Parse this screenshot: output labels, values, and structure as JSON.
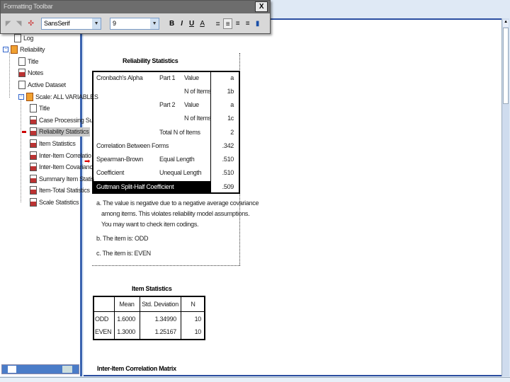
{
  "toolbar": {
    "title": "Formatting Toolbar",
    "close": "X",
    "font": "SansSerif",
    "size": "9",
    "bold": "B",
    "italic": "I",
    "underline": "U",
    "color": "A"
  },
  "tree": [
    {
      "label": "Log",
      "icon": "log-icon"
    },
    {
      "label": "Reliability",
      "icon": "book-icon"
    },
    {
      "label": "Title",
      "icon": "title-icon"
    },
    {
      "label": "Notes",
      "icon": "notes-icon"
    },
    {
      "label": "Active Dataset",
      "icon": "dataset-icon"
    },
    {
      "label": "Scale: ALL VARIABLES",
      "icon": "book-icon"
    },
    {
      "label": "Title",
      "icon": "title-icon"
    },
    {
      "label": "Case Processing Su",
      "icon": "table-icon"
    },
    {
      "label": "Reliability Statistics",
      "icon": "table-icon"
    },
    {
      "label": "Item Statistics",
      "icon": "table-icon"
    },
    {
      "label": "Inter-Item Correlatio",
      "icon": "table-icon"
    },
    {
      "label": "Inter-Item Covarianc",
      "icon": "table-icon"
    },
    {
      "label": "Summary Item Statis",
      "icon": "table-icon"
    },
    {
      "label": "Item-Total Statistics",
      "icon": "table-icon"
    },
    {
      "label": "Scale Statistics",
      "icon": "table-icon"
    }
  ],
  "reliability": {
    "title": "Reliability Statistics",
    "rows": [
      {
        "c1": "Cronbach's Alpha",
        "c2": "Part 1",
        "c3": "Value",
        "v": "a"
      },
      {
        "c1": "",
        "c2": "",
        "c3": "N of Items",
        "v": "1b"
      },
      {
        "c1": "",
        "c2": "Part 2",
        "c3": "Value",
        "v": "a"
      },
      {
        "c1": "",
        "c2": "",
        "c3": "N of Items",
        "v": "1c"
      },
      {
        "c1": "",
        "c2": "Total N of Items",
        "c3": "",
        "v": "2"
      },
      {
        "c1": "Correlation Between Forms",
        "c2": "",
        "c3": "",
        "v": ".342"
      },
      {
        "c1": "Spearman-Brown",
        "c2": "Equal Length",
        "c3": "",
        "v": ".510"
      },
      {
        "c1": "Coefficient",
        "c2": "Unequal Length",
        "c3": "",
        "v": ".510"
      },
      {
        "c1": "Guttman Split-Half Coefficient",
        "c2": "",
        "c3": "",
        "v": ".509"
      }
    ],
    "notes": [
      "a. The value is negative due to a negative average covariance",
      "among items. This violates reliability model assumptions.",
      "You may want to check item codings.",
      "b. The item is: ODD",
      "c. The item is: EVEN"
    ]
  },
  "item_stats": {
    "title": "Item Statistics",
    "headers": [
      "",
      "Mean",
      "Std. Deviation",
      "N"
    ],
    "rows": [
      [
        "ODD",
        "1.6000",
        "1.34990",
        "10"
      ],
      [
        "EVEN",
        "1.3000",
        "1.25167",
        "10"
      ]
    ]
  },
  "next_title": "Inter-Item Correlation Matrix"
}
